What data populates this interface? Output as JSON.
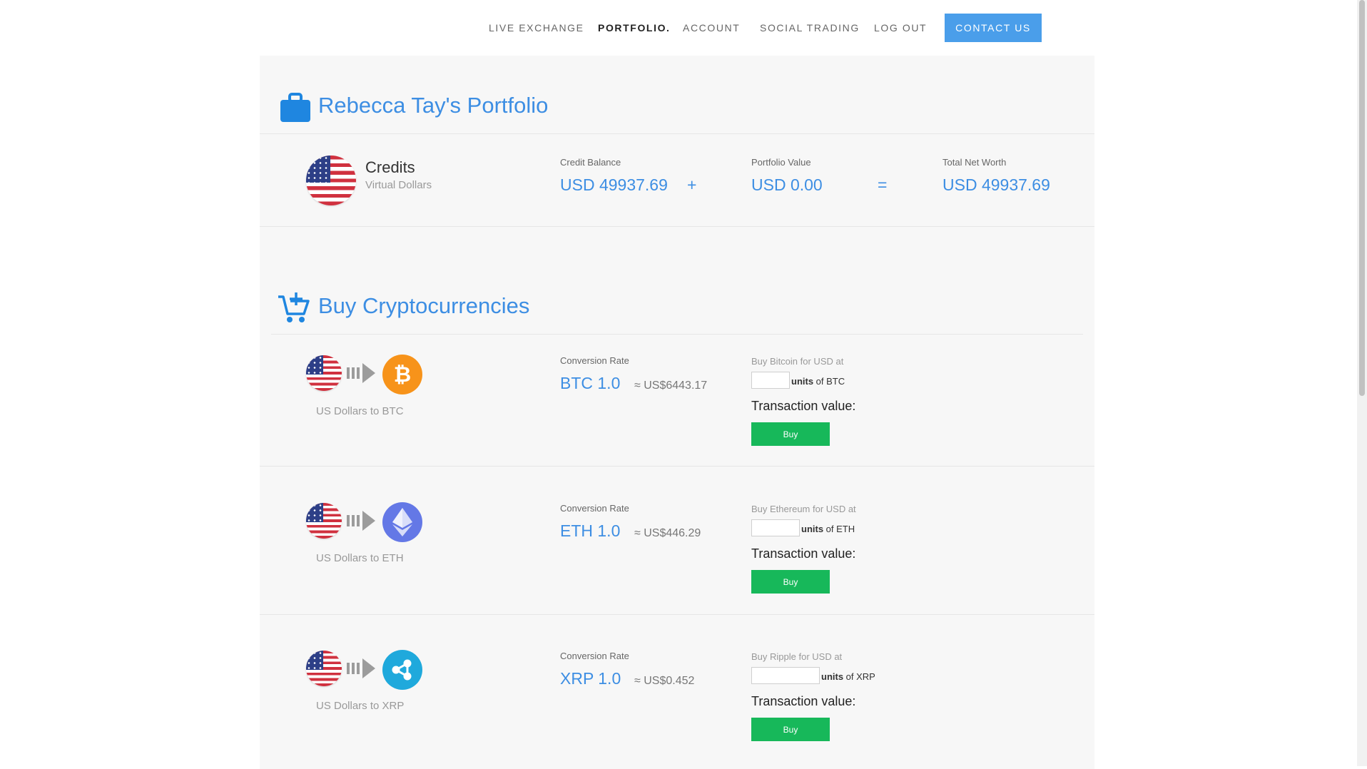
{
  "nav": {
    "items": [
      "LIVE EXCHANGE",
      "PORTFOLIO.",
      "ACCOUNT",
      "SOCIAL TRADING",
      "LOG OUT"
    ],
    "active_index": 1,
    "contact": "CONTACT US"
  },
  "portfolio": {
    "title": "Rebecca Tay's Portfolio",
    "credits_title": "Credits",
    "credits_subtitle": "Virtual Dollars",
    "credit_balance_label": "Credit Balance",
    "credit_balance_value": "USD 49937.69",
    "plus": "+",
    "portfolio_value_label": "Portfolio Value",
    "portfolio_value_value": "USD 0.00",
    "equals": "=",
    "net_worth_label": "Total Net Worth",
    "net_worth_value": "USD 49937.69"
  },
  "buy": {
    "title": "Buy Cryptocurrencies",
    "rows": [
      {
        "caption": "US Dollars to BTC",
        "rate_label": "Conversion Rate",
        "rate_value": "BTC 1.0",
        "approx": "≈ US$6443.17",
        "buy_at": "Buy Bitcoin for USD at",
        "units_bold": "units",
        "units_of": " of BTC",
        "tx_label": "Transaction value:",
        "button": "Buy",
        "coin_icon": "bitcoin-icon",
        "coin_color": "#f7931a"
      },
      {
        "caption": "US Dollars to ETH",
        "rate_label": "Conversion Rate",
        "rate_value": "ETH 1.0",
        "approx": "≈ US$446.29",
        "buy_at": "Buy Ethereum for USD at",
        "units_bold": "units",
        "units_of": " of ETH",
        "tx_label": "Transaction value:",
        "button": "Buy",
        "coin_icon": "ethereum-icon",
        "coin_color": "#6478e6"
      },
      {
        "caption": "US Dollars to XRP",
        "rate_label": "Conversion Rate",
        "rate_value": "XRP 1.0",
        "approx": "≈ US$0.452",
        "buy_at": "Buy Ripple for USD at",
        "units_bold": "units",
        "units_of": " of XRP",
        "tx_label": "Transaction value:",
        "button": "Buy",
        "coin_icon": "ripple-icon",
        "coin_color": "#1fa9dc"
      }
    ]
  },
  "colors": {
    "accent": "#3d8ee3",
    "contact_button": "#4a9eea",
    "buy_button": "#17b85a"
  }
}
